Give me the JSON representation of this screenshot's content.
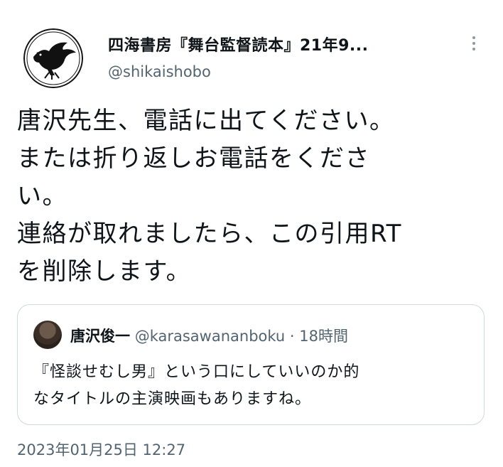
{
  "author": {
    "display_name": "四海書房『舞台監督読本』21年9...",
    "handle": "@shikaishobo",
    "avatar_icon": "crow-logo-icon"
  },
  "tweet": {
    "lines": [
      "唐沢先生、電話に出てください。",
      "または折り返しお電話をくださ",
      "い。",
      "連絡が取れましたら、この引用RT",
      "を削除します。"
    ],
    "timestamp": "2023年01月25日 12:27"
  },
  "quoted_tweet": {
    "display_name": "唐沢俊一",
    "handle": "@karasawananboku",
    "separator": "·",
    "time": "18時間",
    "lines": [
      "『怪談せむし男』という口にしていいのか的",
      "なタイトルの主演映画もありますね。"
    ]
  },
  "colors": {
    "text": "#0f1419",
    "secondary": "#536471",
    "border": "#cfd9de"
  }
}
